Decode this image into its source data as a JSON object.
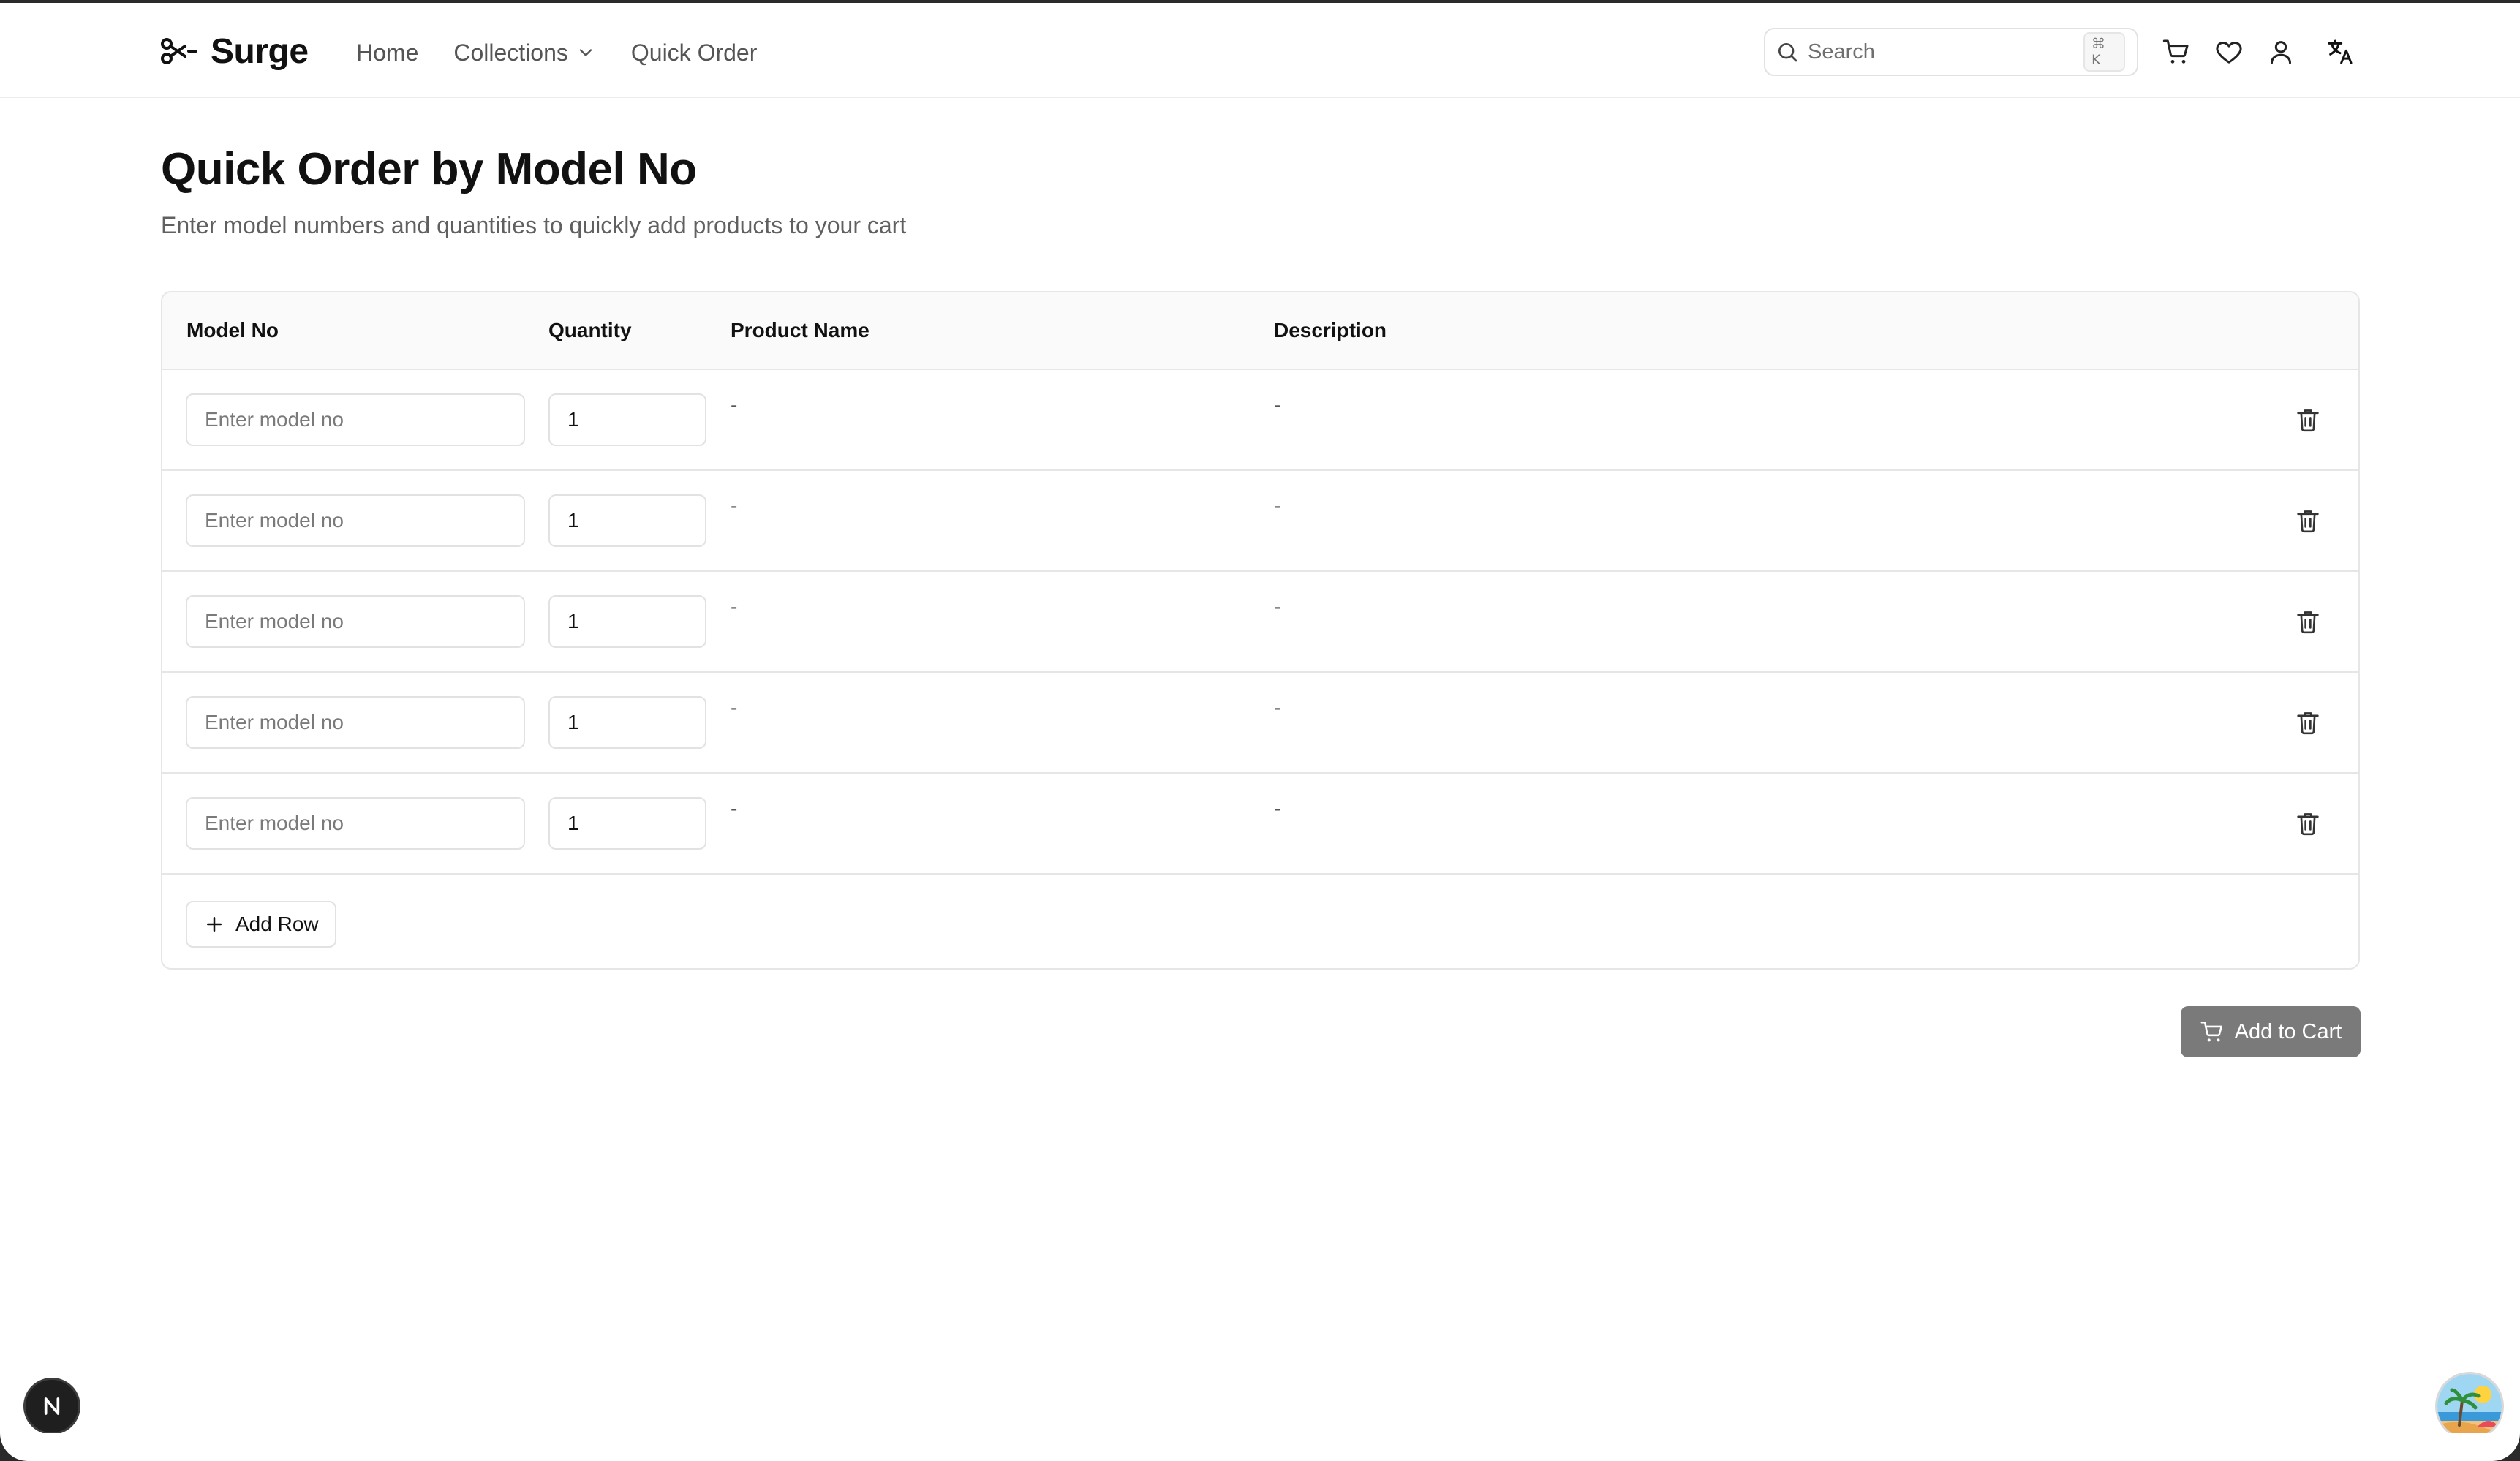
{
  "brand": {
    "name": "Surge"
  },
  "nav": {
    "home": "Home",
    "collections": "Collections",
    "quick_order": "Quick Order"
  },
  "search": {
    "placeholder": "Search",
    "shortcut": "⌘ K"
  },
  "page": {
    "title": "Quick Order by Model No",
    "subtitle": "Enter model numbers and quantities to quickly add products to your cart"
  },
  "table": {
    "headers": {
      "model_no": "Model No",
      "quantity": "Quantity",
      "product_name": "Product Name",
      "description": "Description"
    },
    "rows": [
      {
        "model_placeholder": "Enter model no",
        "quantity": "1",
        "product_name": "-",
        "description": "-"
      },
      {
        "model_placeholder": "Enter model no",
        "quantity": "1",
        "product_name": "-",
        "description": "-"
      },
      {
        "model_placeholder": "Enter model no",
        "quantity": "1",
        "product_name": "-",
        "description": "-"
      },
      {
        "model_placeholder": "Enter model no",
        "quantity": "1",
        "product_name": "-",
        "description": "-"
      },
      {
        "model_placeholder": "Enter model no",
        "quantity": "1",
        "product_name": "-",
        "description": "-"
      }
    ],
    "add_row_label": "Add Row"
  },
  "actions": {
    "add_to_cart_label": "Add to Cart"
  },
  "icons": {
    "logo": "scissors-icon",
    "collections_caret": "chevron-down-icon",
    "search": "search-icon",
    "cart": "cart-icon",
    "wishlist": "heart-icon",
    "account": "user-icon",
    "language": "translate-icon",
    "delete_row": "trash-icon",
    "add_row": "plus-icon",
    "devtools": "nextjs-icon"
  },
  "colors": {
    "button_disabled": "#7a7a7a",
    "text": "#111111",
    "muted": "#606060",
    "border": "#e6e6e6"
  }
}
